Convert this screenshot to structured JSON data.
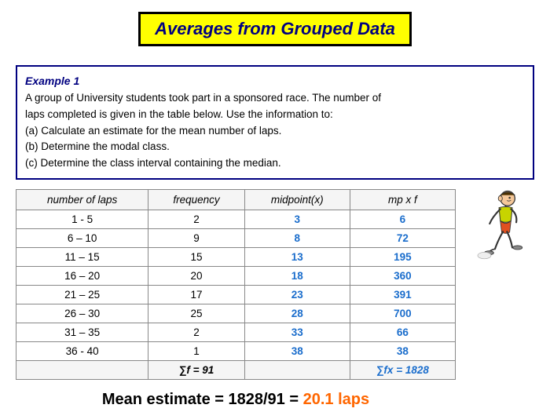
{
  "title": "Averages from Grouped Data",
  "example": {
    "label": "Example 1",
    "text1": "A group of University students took part in a sponsored race. The number of",
    "text2": "laps completed is given in the table below. Use the information to:",
    "text3": "(a) Calculate an estimate for the mean number of laps.",
    "text4": "(b) Determine the modal class.",
    "text5": "(c) Determine the class interval containing the median."
  },
  "table": {
    "headers": [
      "number of laps",
      "frequency",
      "midpoint(x)",
      "mp x f"
    ],
    "rows": [
      {
        "laps": "1 - 5",
        "freq": "2",
        "mid": "3",
        "mpf": "6"
      },
      {
        "laps": "6 – 10",
        "freq": "9",
        "mid": "8",
        "mpf": "72"
      },
      {
        "laps": "11 – 15",
        "freq": "15",
        "mid": "13",
        "mpf": "195"
      },
      {
        "laps": "16 – 20",
        "freq": "20",
        "mid": "18",
        "mpf": "360"
      },
      {
        "laps": "21 – 25",
        "freq": "17",
        "mid": "23",
        "mpf": "391"
      },
      {
        "laps": "26 – 30",
        "freq": "25",
        "mid": "28",
        "mpf": "700"
      },
      {
        "laps": "31 – 35",
        "freq": "2",
        "mid": "33",
        "mpf": "66"
      },
      {
        "laps": "36 - 40",
        "freq": "1",
        "mid": "38",
        "mpf": "38"
      }
    ],
    "sum_freq": "∑f = 91",
    "sum_mpf": "∑fx = 1828"
  },
  "mean_line": {
    "prefix": "Mean estimate = 1828/91 = ",
    "value": "20.1 laps"
  }
}
